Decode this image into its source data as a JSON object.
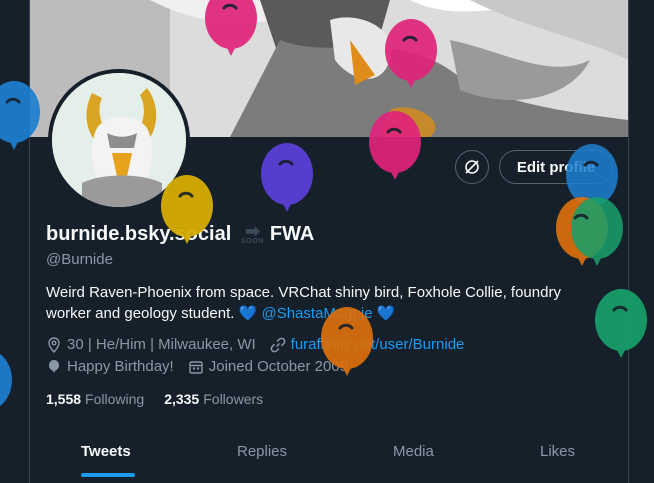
{
  "profile": {
    "display_name": "burnide.bsky.social",
    "display_name_suffix": "FWA",
    "soon_label": "SOON",
    "handle": "@Burnide",
    "bio_text": "Weird Raven-Phoenix from space. VRChat shiny bird, Foxhole Collie, foundry worker and geology student.",
    "bio_heart": "💙",
    "bio_mention": "@ShastaMagpie",
    "location": "30 | He/Him | Milwaukee, WI",
    "website": "furaffinity.net/user/Burnide",
    "birthday": "Happy Birthday!",
    "joined": "Joined October 2009",
    "following_count": "1,558",
    "following_label": "Following",
    "followers_count": "2,335",
    "followers_label": "Followers"
  },
  "actions": {
    "edit_profile": "Edit profile"
  },
  "tabs": [
    {
      "label": "Tweets",
      "active": true
    },
    {
      "label": "Replies",
      "active": false
    },
    {
      "label": "Media",
      "active": false
    },
    {
      "label": "Likes",
      "active": false
    }
  ],
  "colors": {
    "background": "#15202b",
    "accent": "#1d9bf0",
    "muted_text": "#8b98a5",
    "balloon_pink": "#e0247a",
    "balloon_blue": "#1d7fd1",
    "balloon_purple": "#5b3fd6",
    "balloon_yellow": "#d6ad00",
    "balloon_orange": "#e0700a",
    "balloon_green": "#18a06b"
  },
  "decorations": {
    "balloons": "birthday-balloons"
  }
}
